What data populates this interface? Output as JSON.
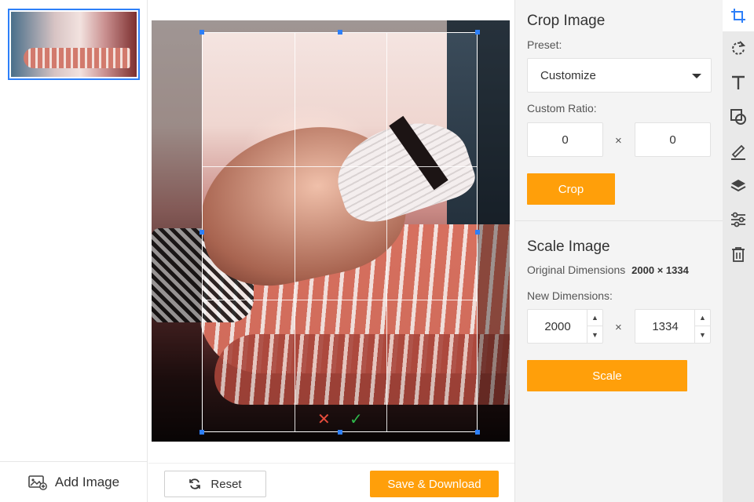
{
  "sidebar": {
    "add_image_label": "Add Image"
  },
  "editor": {
    "crop_cancel_glyph": "✕",
    "crop_confirm_glyph": "✓"
  },
  "actions": {
    "reset_label": "Reset",
    "save_label": "Save & Download"
  },
  "crop_panel": {
    "title": "Crop Image",
    "preset_label": "Preset:",
    "preset_value": "Customize",
    "custom_ratio_label": "Custom Ratio:",
    "ratio_width": "0",
    "ratio_separator": "×",
    "ratio_height": "0",
    "crop_button": "Crop"
  },
  "scale_panel": {
    "title": "Scale Image",
    "original_label": "Original Dimensions",
    "original_value": "2000 × 1334",
    "new_label": "New Dimensions:",
    "new_width": "2000",
    "separator": "×",
    "new_height": "1334",
    "scale_button": "Scale"
  },
  "tools": [
    "crop-icon",
    "rotate-icon",
    "text-icon",
    "shapes-icon",
    "draw-icon",
    "layers-icon",
    "adjust-icon",
    "delete-icon"
  ],
  "colors": {
    "accent": "#ff9f0a",
    "selection": "#2d7ff9",
    "cancel": "#e74c3c",
    "confirm": "#2eb84b"
  }
}
